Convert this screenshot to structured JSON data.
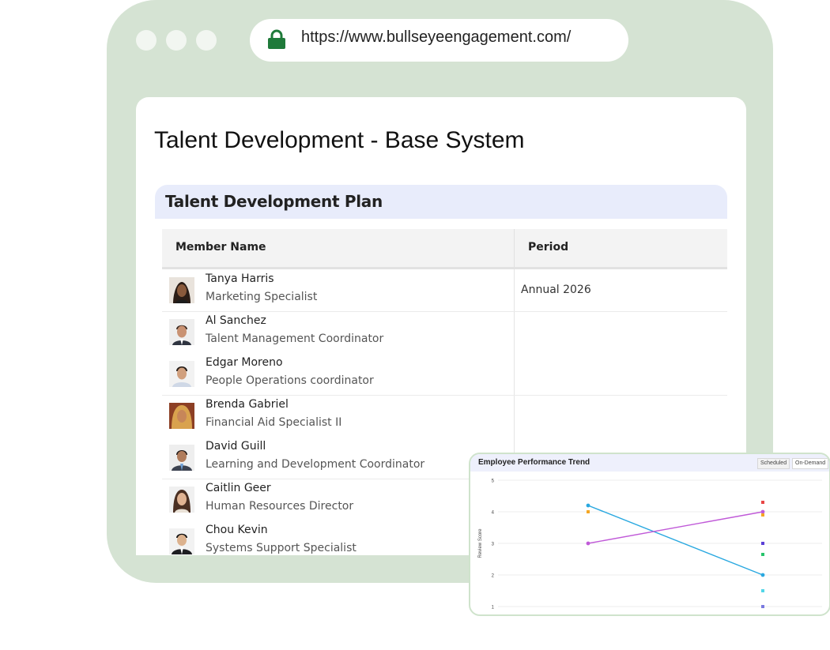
{
  "browser": {
    "url": "https://www.bullseyeengagement.com/",
    "icons": {
      "lock": "lock-icon"
    },
    "lock_color": "#1f7a3a"
  },
  "page": {
    "title": "Talent Development - Base System"
  },
  "plan": {
    "title": "Talent Development Plan",
    "columns": [
      "Member Name",
      "Period"
    ],
    "members": [
      {
        "name": "Tanya Harris",
        "role": "Marketing Specialist"
      },
      {
        "name": "Al Sanchez",
        "role": "Talent Management Coordinator"
      },
      {
        "name": "Edgar Moreno",
        "role": "People Operations coordinator"
      },
      {
        "name": "Brenda Gabriel",
        "role": "Financial Aid Specialist II"
      },
      {
        "name": "David Guill",
        "role": "Learning and Development Coordinator"
      },
      {
        "name": "Caitlin Geer",
        "role": "Human Resources Director"
      },
      {
        "name": "Chou Kevin",
        "role": "Systems Support Specialist"
      }
    ],
    "period": "Annual 2026"
  },
  "chart_widget": {
    "title": "Employee Performance Trend",
    "tabs": [
      "Scheduled",
      "On-Demand"
    ],
    "selected_tab": "Scheduled"
  },
  "chart_data": {
    "type": "line",
    "title": "Employee Performance Trend",
    "xlabel": "",
    "ylabel": "Review Score",
    "ylim": [
      1,
      5
    ],
    "yticks": [
      "1",
      "2",
      "3",
      "4",
      "5"
    ],
    "grid": true,
    "series": [
      {
        "color": "#29a8e0",
        "points": [
          [
            1,
            4.2
          ],
          [
            2,
            2.0
          ]
        ]
      },
      {
        "color": "#c05ad8",
        "points": [
          [
            1,
            3.0
          ],
          [
            2,
            4.0
          ]
        ]
      }
    ],
    "markers": [
      {
        "color": "#f5a623",
        "x": 1,
        "y": 4.0
      },
      {
        "color": "#e84646",
        "x": 2,
        "y": 4.3
      },
      {
        "color": "#f5a623",
        "x": 2,
        "y": 3.9
      },
      {
        "color": "#5b3fd6",
        "x": 2,
        "y": 3.0
      },
      {
        "color": "#27c46b",
        "x": 2,
        "y": 2.65
      },
      {
        "color": "#52d6e8",
        "x": 2,
        "y": 1.5
      },
      {
        "color": "#7a7ae0",
        "x": 2,
        "y": 1.0
      }
    ]
  }
}
